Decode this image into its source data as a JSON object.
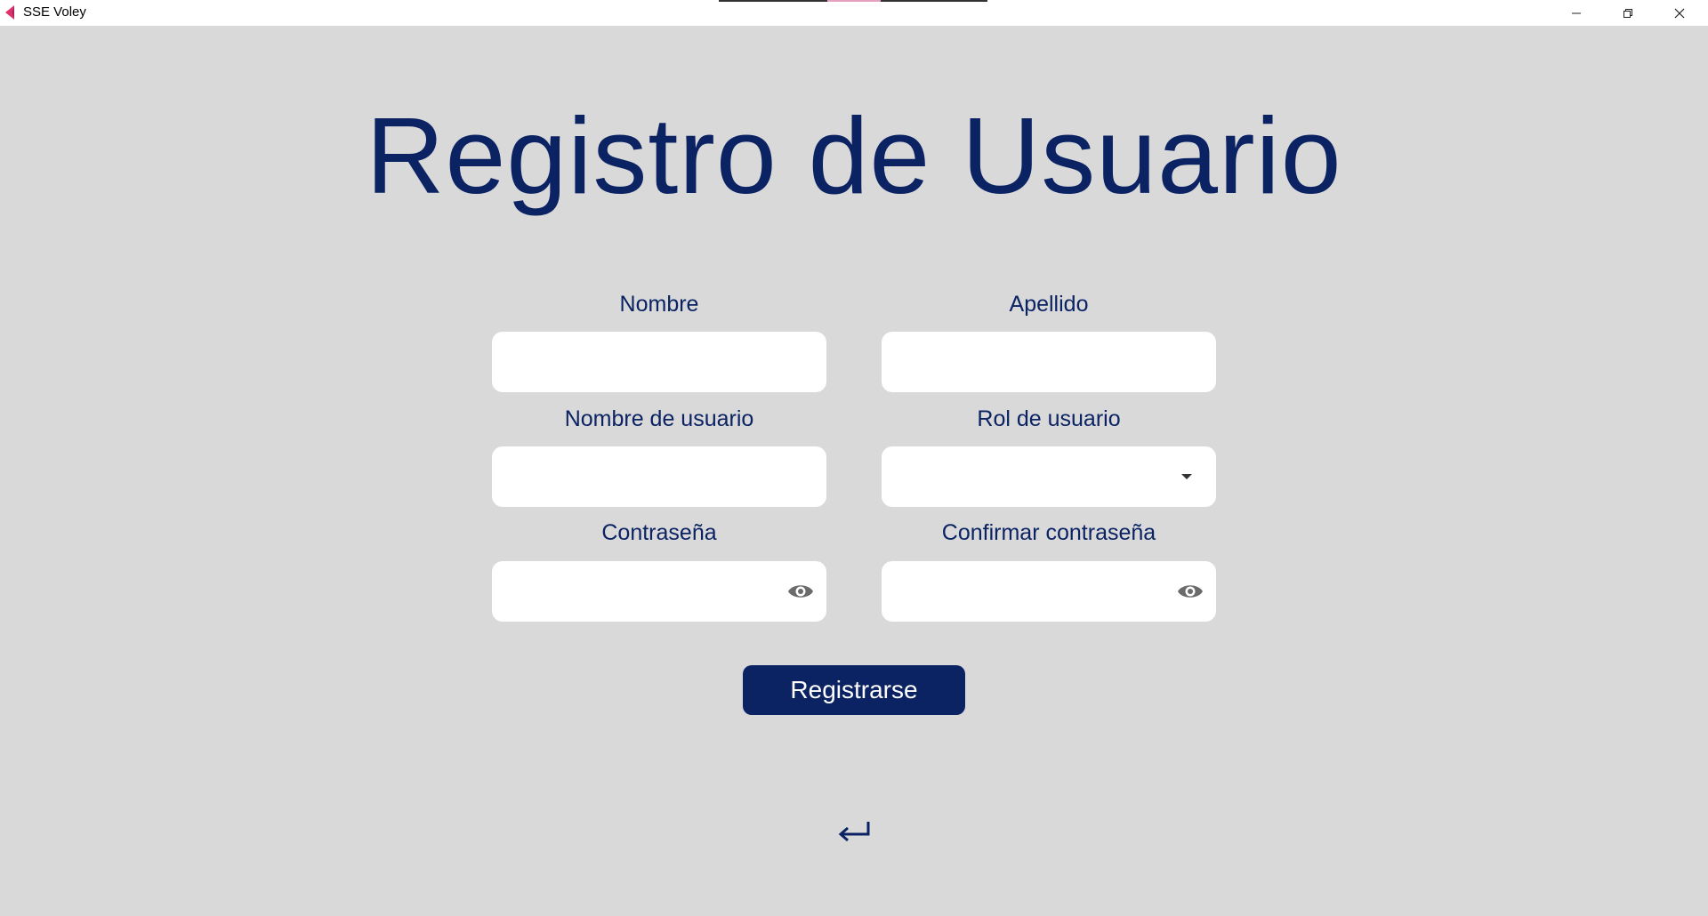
{
  "window": {
    "title": "SSE Voley",
    "icon": "app-logo-icon",
    "controls": [
      "minimize-icon",
      "maximize-icon",
      "close-icon"
    ]
  },
  "page": {
    "title": "Registro de Usuario"
  },
  "form": {
    "nombre": {
      "label": "Nombre",
      "value": ""
    },
    "apellido": {
      "label": "Apellido",
      "value": ""
    },
    "nombre_usuario": {
      "label": "Nombre de usuario",
      "value": ""
    },
    "rol_usuario": {
      "label": "Rol de usuario",
      "value": "",
      "icon": "chevron-down-icon"
    },
    "contrasena": {
      "label": "Contraseña",
      "value": "",
      "icon": "eye-icon"
    },
    "confirmar_contrasena": {
      "label": "Confirmar contraseña",
      "value": "",
      "icon": "eye-icon"
    }
  },
  "actions": {
    "register_label": "Registrarse",
    "back_icon": "back-arrow-icon"
  },
  "colors": {
    "primary": "#0b2363",
    "background": "#d9d9da",
    "field": "#ffffff",
    "icon_gray": "#6b6b6b",
    "logo_accent": "#e0306a"
  }
}
